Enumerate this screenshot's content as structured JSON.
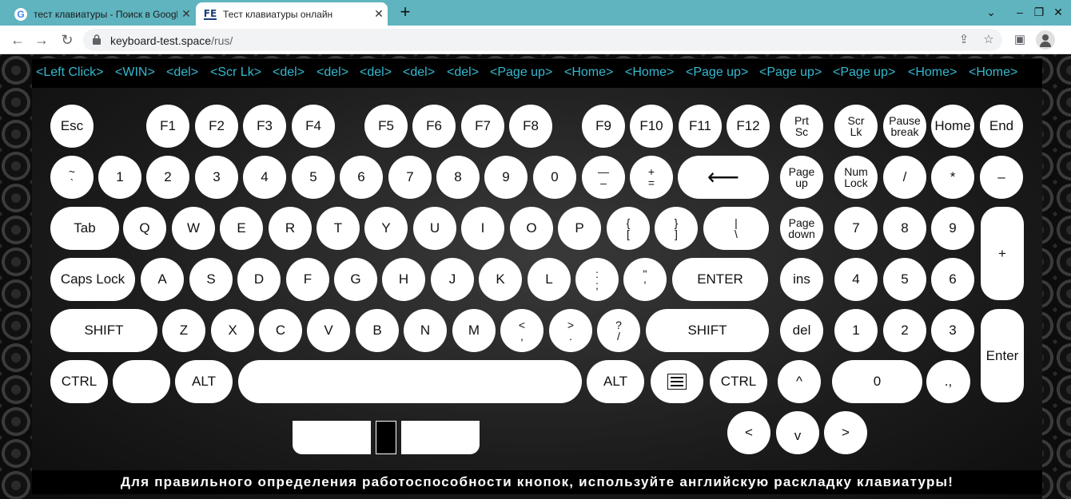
{
  "browser": {
    "tabs": [
      {
        "title": "тест клавиатуры - Поиск в Google",
        "icon": "google-icon"
      },
      {
        "title": "Тест клавиатуры онлайн",
        "icon": "fe-site-icon",
        "favicon_text": "FE"
      }
    ],
    "new_tab": "+",
    "window_controls": {
      "collapse": "⌄",
      "minimize": "–",
      "restore": "❐",
      "close": "✕"
    },
    "url_host": "keyboard-test.space",
    "url_path": "/rus/"
  },
  "log": [
    "<Left Click>",
    "<WIN>",
    "<del>",
    "<Scr Lk>",
    "<del>",
    "<del>",
    "<del>",
    "<del>",
    "<del>",
    "<Page up>",
    "<Home>",
    "<Home>",
    "<Page up>",
    "<Page up>",
    "<Page up>",
    "<Home>",
    "<Home>"
  ],
  "footer_text": "Для правильного определения работоспособности кнопок, используйте английскую раскладку клавиатуры!",
  "keys": {
    "row_fn": [
      "Esc",
      "F1",
      "F2",
      "F3",
      "F4",
      "F5",
      "F6",
      "F7",
      "F8",
      "F9",
      "F10",
      "F11",
      "F12"
    ],
    "row_nav1": [
      [
        "Prt",
        "Sc"
      ],
      [
        "Scr",
        "Lk"
      ],
      [
        "Pause",
        "break"
      ],
      "Home",
      "End"
    ],
    "row_num": [
      [
        "~",
        "`"
      ],
      "1",
      "2",
      "3",
      "4",
      "5",
      "6",
      "7",
      "8",
      "9",
      "0",
      [
        "—",
        "–"
      ],
      [
        "+",
        "="
      ],
      "⟵"
    ],
    "row_nav2": [
      [
        "Page",
        "up"
      ],
      [
        "Num",
        "Lock"
      ],
      "/",
      "*",
      "–"
    ],
    "row_q": [
      "Tab",
      "Q",
      "W",
      "E",
      "R",
      "T",
      "Y",
      "U",
      "I",
      "O",
      "P",
      [
        "{",
        "["
      ],
      [
        "}",
        "]"
      ],
      [
        "|",
        "\\"
      ]
    ],
    "row_nav3": [
      [
        "Page",
        "down"
      ],
      "7",
      "8",
      "9",
      "+"
    ],
    "row_a": [
      "Caps Lock",
      "A",
      "S",
      "D",
      "F",
      "G",
      "H",
      "J",
      "K",
      "L",
      [
        ":",
        ";"
      ],
      [
        "\"",
        "'"
      ],
      "ENTER"
    ],
    "row_nav4": [
      "ins",
      "4",
      "5",
      "6"
    ],
    "row_z": [
      "SHIFT",
      "Z",
      "X",
      "C",
      "V",
      "B",
      "N",
      "M",
      [
        "<",
        ","
      ],
      [
        ">",
        "."
      ],
      [
        "?",
        "/"
      ],
      "SHIFT"
    ],
    "row_nav5": [
      "del",
      "1",
      "2",
      "3",
      "Enter"
    ],
    "row_ctrl": [
      "CTRL",
      "",
      "ALT",
      "",
      "ALT",
      "",
      "CTRL"
    ],
    "row_nav6": [
      "^",
      "0",
      ".,"
    ],
    "arrows": [
      "<",
      "v",
      ">"
    ]
  }
}
